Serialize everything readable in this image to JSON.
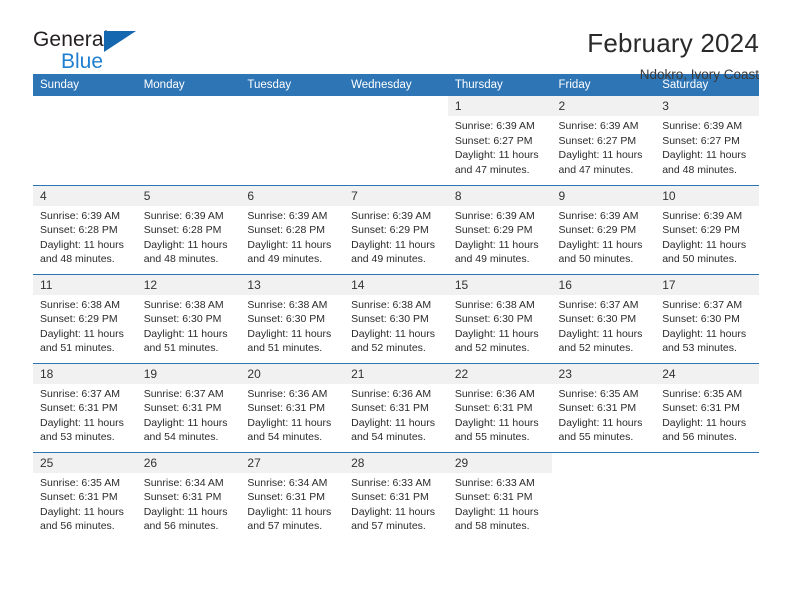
{
  "brand": {
    "name_top": "General",
    "name_bottom": "Blue",
    "flag_icon": "triangle-flag-icon",
    "accent_color": "#1567b0"
  },
  "header": {
    "title": "February 2024",
    "subtitle": "Ndokro, Ivory Coast"
  },
  "theme": {
    "header_bg": "#2e75b6",
    "header_text": "#ffffff",
    "daynum_bg": "#f1f1f1",
    "row_divider": "#2e75b6"
  },
  "weekday_headers": [
    "Sunday",
    "Monday",
    "Tuesday",
    "Wednesday",
    "Thursday",
    "Friday",
    "Saturday"
  ],
  "weeks": [
    [
      {
        "day": "",
        "empty": true,
        "sunrise": "",
        "sunset": "",
        "daylight_line1": "",
        "daylight_line2": ""
      },
      {
        "day": "",
        "empty": true,
        "sunrise": "",
        "sunset": "",
        "daylight_line1": "",
        "daylight_line2": ""
      },
      {
        "day": "",
        "empty": true,
        "sunrise": "",
        "sunset": "",
        "daylight_line1": "",
        "daylight_line2": ""
      },
      {
        "day": "",
        "empty": true,
        "sunrise": "",
        "sunset": "",
        "daylight_line1": "",
        "daylight_line2": ""
      },
      {
        "day": "1",
        "empty": false,
        "sunrise": "Sunrise: 6:39 AM",
        "sunset": "Sunset: 6:27 PM",
        "daylight_line1": "Daylight: 11 hours",
        "daylight_line2": "and 47 minutes."
      },
      {
        "day": "2",
        "empty": false,
        "sunrise": "Sunrise: 6:39 AM",
        "sunset": "Sunset: 6:27 PM",
        "daylight_line1": "Daylight: 11 hours",
        "daylight_line2": "and 47 minutes."
      },
      {
        "day": "3",
        "empty": false,
        "sunrise": "Sunrise: 6:39 AM",
        "sunset": "Sunset: 6:27 PM",
        "daylight_line1": "Daylight: 11 hours",
        "daylight_line2": "and 48 minutes."
      }
    ],
    [
      {
        "day": "4",
        "empty": false,
        "sunrise": "Sunrise: 6:39 AM",
        "sunset": "Sunset: 6:28 PM",
        "daylight_line1": "Daylight: 11 hours",
        "daylight_line2": "and 48 minutes."
      },
      {
        "day": "5",
        "empty": false,
        "sunrise": "Sunrise: 6:39 AM",
        "sunset": "Sunset: 6:28 PM",
        "daylight_line1": "Daylight: 11 hours",
        "daylight_line2": "and 48 minutes."
      },
      {
        "day": "6",
        "empty": false,
        "sunrise": "Sunrise: 6:39 AM",
        "sunset": "Sunset: 6:28 PM",
        "daylight_line1": "Daylight: 11 hours",
        "daylight_line2": "and 49 minutes."
      },
      {
        "day": "7",
        "empty": false,
        "sunrise": "Sunrise: 6:39 AM",
        "sunset": "Sunset: 6:29 PM",
        "daylight_line1": "Daylight: 11 hours",
        "daylight_line2": "and 49 minutes."
      },
      {
        "day": "8",
        "empty": false,
        "sunrise": "Sunrise: 6:39 AM",
        "sunset": "Sunset: 6:29 PM",
        "daylight_line1": "Daylight: 11 hours",
        "daylight_line2": "and 49 minutes."
      },
      {
        "day": "9",
        "empty": false,
        "sunrise": "Sunrise: 6:39 AM",
        "sunset": "Sunset: 6:29 PM",
        "daylight_line1": "Daylight: 11 hours",
        "daylight_line2": "and 50 minutes."
      },
      {
        "day": "10",
        "empty": false,
        "sunrise": "Sunrise: 6:39 AM",
        "sunset": "Sunset: 6:29 PM",
        "daylight_line1": "Daylight: 11 hours",
        "daylight_line2": "and 50 minutes."
      }
    ],
    [
      {
        "day": "11",
        "empty": false,
        "sunrise": "Sunrise: 6:38 AM",
        "sunset": "Sunset: 6:29 PM",
        "daylight_line1": "Daylight: 11 hours",
        "daylight_line2": "and 51 minutes."
      },
      {
        "day": "12",
        "empty": false,
        "sunrise": "Sunrise: 6:38 AM",
        "sunset": "Sunset: 6:30 PM",
        "daylight_line1": "Daylight: 11 hours",
        "daylight_line2": "and 51 minutes."
      },
      {
        "day": "13",
        "empty": false,
        "sunrise": "Sunrise: 6:38 AM",
        "sunset": "Sunset: 6:30 PM",
        "daylight_line1": "Daylight: 11 hours",
        "daylight_line2": "and 51 minutes."
      },
      {
        "day": "14",
        "empty": false,
        "sunrise": "Sunrise: 6:38 AM",
        "sunset": "Sunset: 6:30 PM",
        "daylight_line1": "Daylight: 11 hours",
        "daylight_line2": "and 52 minutes."
      },
      {
        "day": "15",
        "empty": false,
        "sunrise": "Sunrise: 6:38 AM",
        "sunset": "Sunset: 6:30 PM",
        "daylight_line1": "Daylight: 11 hours",
        "daylight_line2": "and 52 minutes."
      },
      {
        "day": "16",
        "empty": false,
        "sunrise": "Sunrise: 6:37 AM",
        "sunset": "Sunset: 6:30 PM",
        "daylight_line1": "Daylight: 11 hours",
        "daylight_line2": "and 52 minutes."
      },
      {
        "day": "17",
        "empty": false,
        "sunrise": "Sunrise: 6:37 AM",
        "sunset": "Sunset: 6:30 PM",
        "daylight_line1": "Daylight: 11 hours",
        "daylight_line2": "and 53 minutes."
      }
    ],
    [
      {
        "day": "18",
        "empty": false,
        "sunrise": "Sunrise: 6:37 AM",
        "sunset": "Sunset: 6:31 PM",
        "daylight_line1": "Daylight: 11 hours",
        "daylight_line2": "and 53 minutes."
      },
      {
        "day": "19",
        "empty": false,
        "sunrise": "Sunrise: 6:37 AM",
        "sunset": "Sunset: 6:31 PM",
        "daylight_line1": "Daylight: 11 hours",
        "daylight_line2": "and 54 minutes."
      },
      {
        "day": "20",
        "empty": false,
        "sunrise": "Sunrise: 6:36 AM",
        "sunset": "Sunset: 6:31 PM",
        "daylight_line1": "Daylight: 11 hours",
        "daylight_line2": "and 54 minutes."
      },
      {
        "day": "21",
        "empty": false,
        "sunrise": "Sunrise: 6:36 AM",
        "sunset": "Sunset: 6:31 PM",
        "daylight_line1": "Daylight: 11 hours",
        "daylight_line2": "and 54 minutes."
      },
      {
        "day": "22",
        "empty": false,
        "sunrise": "Sunrise: 6:36 AM",
        "sunset": "Sunset: 6:31 PM",
        "daylight_line1": "Daylight: 11 hours",
        "daylight_line2": "and 55 minutes."
      },
      {
        "day": "23",
        "empty": false,
        "sunrise": "Sunrise: 6:35 AM",
        "sunset": "Sunset: 6:31 PM",
        "daylight_line1": "Daylight: 11 hours",
        "daylight_line2": "and 55 minutes."
      },
      {
        "day": "24",
        "empty": false,
        "sunrise": "Sunrise: 6:35 AM",
        "sunset": "Sunset: 6:31 PM",
        "daylight_line1": "Daylight: 11 hours",
        "daylight_line2": "and 56 minutes."
      }
    ],
    [
      {
        "day": "25",
        "empty": false,
        "sunrise": "Sunrise: 6:35 AM",
        "sunset": "Sunset: 6:31 PM",
        "daylight_line1": "Daylight: 11 hours",
        "daylight_line2": "and 56 minutes."
      },
      {
        "day": "26",
        "empty": false,
        "sunrise": "Sunrise: 6:34 AM",
        "sunset": "Sunset: 6:31 PM",
        "daylight_line1": "Daylight: 11 hours",
        "daylight_line2": "and 56 minutes."
      },
      {
        "day": "27",
        "empty": false,
        "sunrise": "Sunrise: 6:34 AM",
        "sunset": "Sunset: 6:31 PM",
        "daylight_line1": "Daylight: 11 hours",
        "daylight_line2": "and 57 minutes."
      },
      {
        "day": "28",
        "empty": false,
        "sunrise": "Sunrise: 6:33 AM",
        "sunset": "Sunset: 6:31 PM",
        "daylight_line1": "Daylight: 11 hours",
        "daylight_line2": "and 57 minutes."
      },
      {
        "day": "29",
        "empty": false,
        "sunrise": "Sunrise: 6:33 AM",
        "sunset": "Sunset: 6:31 PM",
        "daylight_line1": "Daylight: 11 hours",
        "daylight_line2": "and 58 minutes."
      },
      {
        "day": "",
        "empty": true,
        "sunrise": "",
        "sunset": "",
        "daylight_line1": "",
        "daylight_line2": ""
      },
      {
        "day": "",
        "empty": true,
        "sunrise": "",
        "sunset": "",
        "daylight_line1": "",
        "daylight_line2": ""
      }
    ]
  ]
}
